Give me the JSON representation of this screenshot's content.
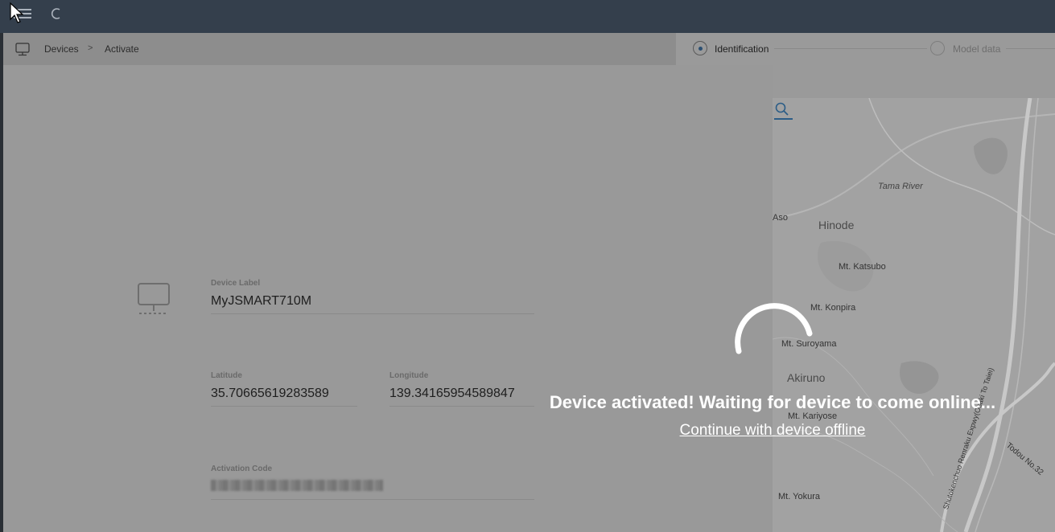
{
  "breadcrumb": {
    "devices": "Devices",
    "separator": ">",
    "current": "Activate"
  },
  "stepper": {
    "steps": [
      {
        "label": "Identification",
        "state": "active"
      },
      {
        "label": "Model data",
        "state": "pending"
      }
    ]
  },
  "form": {
    "device_label": {
      "label": "Device Label",
      "value": "MyJSMART710M"
    },
    "latitude": {
      "label": "Latitude",
      "value": "35.70665619283589"
    },
    "longitude": {
      "label": "Longitude",
      "value": "139.34165954589847"
    },
    "activation_code": {
      "label": "Activation Code"
    }
  },
  "map": {
    "labels": {
      "tama_river": "Tama River",
      "aso": "Aso",
      "hinode": "Hinode",
      "katsubo": "Mt. Katsubo",
      "konpira": "Mt. Konpira",
      "suroyama": "Mt. Suroyama",
      "akiruno": "Akiruno",
      "kariyose": "Mt. Kariyose",
      "yokura": "Mt. Yokura",
      "expwy": "Shutokenchuo Renraku Expwy(Osaki To Taiei)",
      "todou": "Todou No.32"
    }
  },
  "overlay": {
    "message": "Device activated! Waiting for device to come online...",
    "link": "Continue with device offline"
  },
  "colors": {
    "topbar": "#343f4c",
    "accent": "#2c5d87"
  }
}
